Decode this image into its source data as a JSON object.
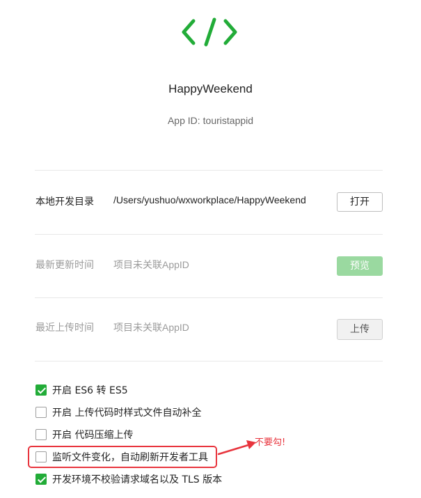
{
  "app": {
    "name": "HappyWeekend",
    "id_label": "App ID:",
    "id_value": "touristappid",
    "logo_icon": "code-brackets-icon",
    "brand_color": "#22ac38"
  },
  "rows": {
    "local_dir": {
      "label": "本地开发目录",
      "value": "/Users/yushuo/wxworkplace/HappyWeekend",
      "button": "打开"
    },
    "last_update": {
      "label": "最新更新时间",
      "value": "项目未关联AppID",
      "button": "预览"
    },
    "last_upload": {
      "label": "最近上传时间",
      "value": "项目未关联AppID",
      "button": "上传"
    }
  },
  "options": [
    {
      "label": "开启 ES6 转 ES5",
      "checked": true
    },
    {
      "label": "开启 上传代码时样式文件自动补全",
      "checked": false
    },
    {
      "label": "开启 代码压缩上传",
      "checked": false
    },
    {
      "label": "监听文件变化，自动刷新开发者工具",
      "checked": false
    },
    {
      "label": "开发环境不校验请求域名以及 TLS 版本",
      "checked": true
    }
  ],
  "annotation": {
    "text": "不要勾!",
    "color": "#e8343d"
  }
}
